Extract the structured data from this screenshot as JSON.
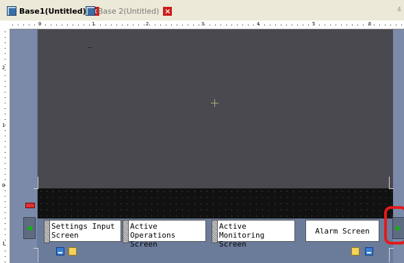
{
  "tabs": [
    {
      "label": "Base1(Untitled)",
      "active": true
    },
    {
      "label": "Base 2(Untitled)",
      "active": false
    }
  ],
  "tab_scroll_label": "4",
  "ruler": {
    "top_numbers": [
      "0",
      "1",
      "2",
      "3",
      "4",
      "5",
      "6"
    ],
    "left_numbers": [
      "2",
      "1",
      "0",
      "1"
    ]
  },
  "screen_buttons": [
    {
      "label": "Settings Input Screen"
    },
    {
      "label": "Active Operations Screen"
    },
    {
      "label": "Active Monitoring Screen"
    },
    {
      "label": "Alarm Screen"
    }
  ],
  "colors": {
    "screen_background": "#4b4950",
    "workspace_background": "#6b7b9a",
    "highlight": "#e21b1b",
    "nav_arrow": "#00c000"
  },
  "icons": {
    "tab_icon": "screen-icon",
    "tab_close": "close-icon",
    "nav_prev": "arrow-left-icon",
    "nav_next": "arrow-right-icon",
    "new_screen": "new-screen-icon",
    "open_folder": "folder-icon"
  }
}
